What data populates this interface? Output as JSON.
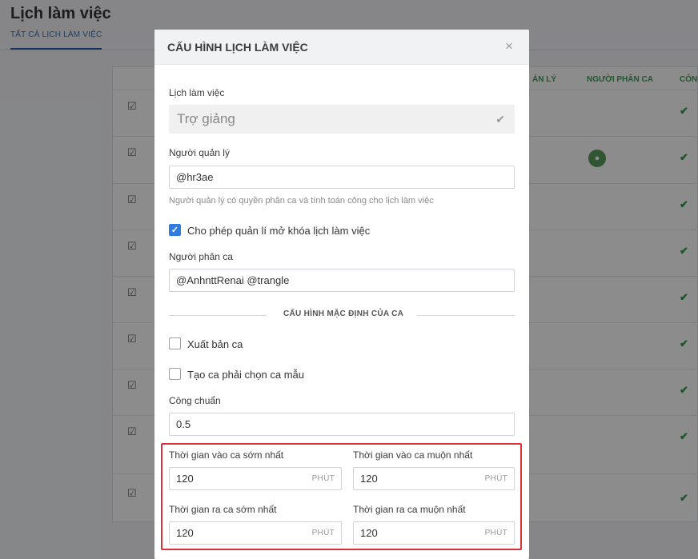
{
  "page": {
    "title": "Lịch làm việc",
    "tab": "TẤT CẢ LỊCH LÀM VIỆC",
    "columns": [
      "ẢN LÝ",
      "NGƯỜI PHÂN CA",
      "CÔNG"
    ],
    "check_glyph": "✔",
    "calendar_glyph": "📅"
  },
  "modal": {
    "title": "CẤU HÌNH LỊCH LÀM VIỆC",
    "close_glyph": "×",
    "schedule": {
      "label": "Lịch làm việc",
      "value": "Trợ giảng",
      "check": "✔"
    },
    "manager": {
      "label": "Người quản lý",
      "value": "@hr3ae",
      "hint": "Người quản lý có quyền phân ca và tính toán công cho lịch làm việc"
    },
    "allow_unlock": {
      "label": "Cho phép quản lí mở khóa lịch làm việc",
      "checked": true,
      "mark": "✓"
    },
    "assigner": {
      "label": "Người phân ca",
      "value": "@AnhnttRenai @trangle"
    },
    "section_title": "CẤU HÌNH MẶC ĐỊNH CỦA CA",
    "publish_shift": {
      "label": "Xuất bản ca",
      "checked": false
    },
    "require_template": {
      "label": "Tạo ca phải chọn ca mẫu",
      "checked": false
    },
    "standard_work": {
      "label": "Công chuẩn",
      "value": "0.5"
    },
    "earliest_in": {
      "label": "Thời gian vào ca sớm nhất",
      "value": "120",
      "unit": "PHÚT"
    },
    "latest_in": {
      "label": "Thời gian vào ca muộn nhất",
      "value": "120",
      "unit": "PHÚT"
    },
    "earliest_out": {
      "label": "Thời gian ra ca sớm nhất",
      "value": "120",
      "unit": "PHÚT"
    },
    "latest_out": {
      "label": "Thời gian ra ca muộn nhất",
      "value": "120",
      "unit": "PHÚT"
    }
  },
  "colors": {
    "accent": "#2f7de1",
    "highlight": "#d8313a",
    "check_green": "#2e9b45"
  }
}
